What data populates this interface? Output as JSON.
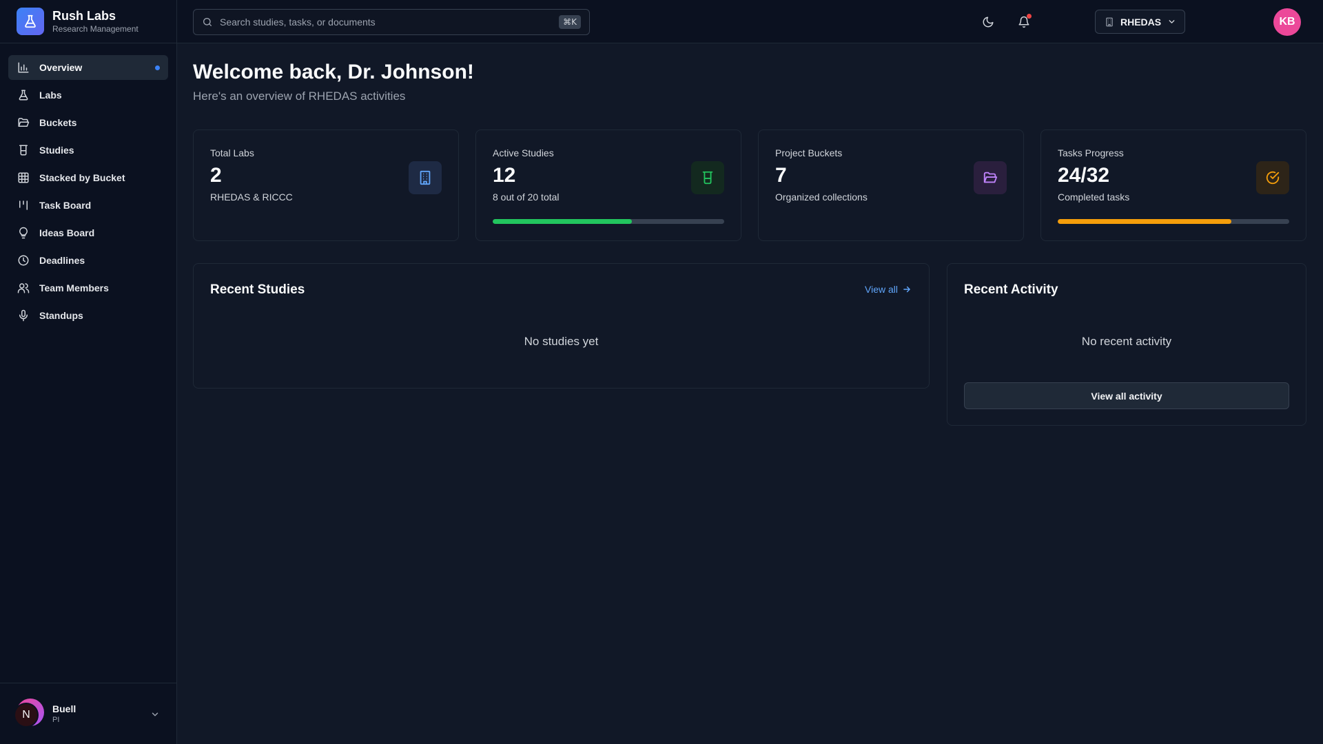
{
  "brand": {
    "name": "Rush Labs",
    "subtitle": "Research Management",
    "color": "#3b82f6"
  },
  "sidebar": {
    "items": [
      {
        "label": "Overview",
        "icon": "bar-chart-icon",
        "active": true
      },
      {
        "label": "Labs",
        "icon": "flask-icon"
      },
      {
        "label": "Buckets",
        "icon": "folder-open-icon"
      },
      {
        "label": "Studies",
        "icon": "beaker-icon"
      },
      {
        "label": "Stacked by Bucket",
        "icon": "grid-icon"
      },
      {
        "label": "Task Board",
        "icon": "kanban-icon"
      },
      {
        "label": "Ideas Board",
        "icon": "lightbulb-icon"
      },
      {
        "label": "Deadlines",
        "icon": "clock-icon"
      },
      {
        "label": "Team Members",
        "icon": "users-icon"
      },
      {
        "label": "Standups",
        "icon": "microphone-icon"
      }
    ]
  },
  "user": {
    "initial": "N",
    "name": "Buell",
    "role": "PI"
  },
  "topbar": {
    "search_placeholder": "Search studies, tasks, or documents",
    "shortcut": "⌘K",
    "lab_selector": "RHEDAS",
    "avatar_initials": "KB",
    "avatar_color": "#ec4899",
    "notification_dot_color": "#ef4444"
  },
  "header": {
    "title": "Welcome back, Dr. Johnson!",
    "subtitle": "Here's an overview of RHEDAS activities"
  },
  "stats": [
    {
      "label": "Total Labs",
      "value": "2",
      "sub": "RHEDAS & RICCC",
      "icon": "building-icon",
      "accent": "#60a5fa",
      "icon_bg": "#1e2a44"
    },
    {
      "label": "Active Studies",
      "value": "12",
      "sub": "8 out of 20 total",
      "icon": "beaker-icon",
      "accent": "#22c55e",
      "icon_bg": "#13291f",
      "progress": 0.6
    },
    {
      "label": "Project Buckets",
      "value": "7",
      "sub": "Organized collections",
      "icon": "folder-open-icon",
      "accent": "#c084fc",
      "icon_bg": "#2a1f3d"
    },
    {
      "label": "Tasks Progress",
      "value": "24/32",
      "sub": "Completed tasks",
      "icon": "check-circle-icon",
      "accent": "#f59e0b",
      "icon_bg": "#2d2418",
      "progress": 0.75
    }
  ],
  "recent_studies": {
    "title": "Recent Studies",
    "view_all": "View all",
    "empty": "No studies yet"
  },
  "recent_activity": {
    "title": "Recent Activity",
    "empty": "No recent activity",
    "button": "View all activity"
  }
}
